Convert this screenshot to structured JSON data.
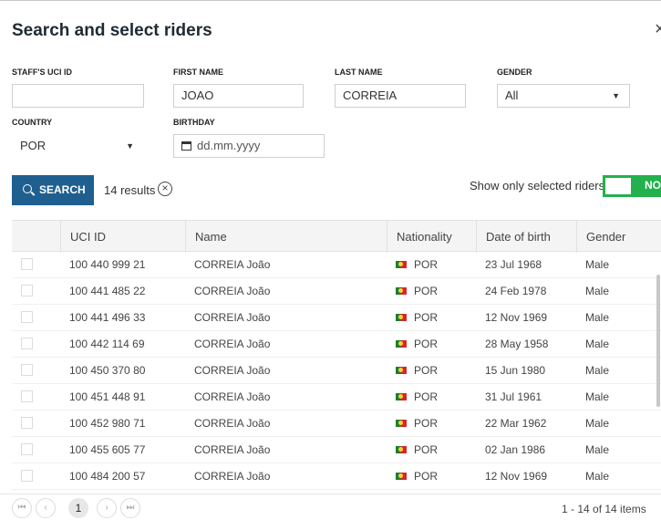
{
  "dialog": {
    "title": "Search and select riders",
    "close_icon": "×"
  },
  "form": {
    "staff_uci_id_label": "STAFF'S UCI ID",
    "staff_uci_id_value": "",
    "first_name_label": "FIRST NAME",
    "first_name_value": "JOAO",
    "last_name_label": "LAST NAME",
    "last_name_value": "CORREIA",
    "gender_label": "GENDER",
    "gender_value": "All",
    "country_label": "COUNTRY",
    "country_value": "POR",
    "birthday_label": "BIRTHDAY",
    "birthday_placeholder": "dd.mm.yyyy"
  },
  "toolbar": {
    "search_label": "SEARCH",
    "results_text": "14 results",
    "clear_icon": "×",
    "show_selected_label": "Show only selected riders",
    "toggle_text": "NO"
  },
  "table": {
    "headers": [
      "UCI ID",
      "Name",
      "Nationality",
      "Date of birth",
      "Gender"
    ],
    "rows": [
      {
        "uci_id": "100 440 999 21",
        "name": "CORREIA João",
        "nationality": "POR",
        "dob": "23 Jul 1968",
        "gender": "Male"
      },
      {
        "uci_id": "100 441 485 22",
        "name": "CORREIA João",
        "nationality": "POR",
        "dob": "24 Feb 1978",
        "gender": "Male"
      },
      {
        "uci_id": "100 441 496 33",
        "name": "CORREIA João",
        "nationality": "POR",
        "dob": "12 Nov 1969",
        "gender": "Male"
      },
      {
        "uci_id": "100 442 114 69",
        "name": "CORREIA João",
        "nationality": "POR",
        "dob": "28 May 1958",
        "gender": "Male"
      },
      {
        "uci_id": "100 450 370 80",
        "name": "CORREIA João",
        "nationality": "POR",
        "dob": "15 Jun 1980",
        "gender": "Male"
      },
      {
        "uci_id": "100 451 448 91",
        "name": "CORREIA João",
        "nationality": "POR",
        "dob": "31 Jul 1961",
        "gender": "Male"
      },
      {
        "uci_id": "100 452 980 71",
        "name": "CORREIA João",
        "nationality": "POR",
        "dob": "22 Mar 1962",
        "gender": "Male"
      },
      {
        "uci_id": "100 455 605 77",
        "name": "CORREIA João",
        "nationality": "POR",
        "dob": "02 Jan 1986",
        "gender": "Male"
      },
      {
        "uci_id": "100 484 200 57",
        "name": "CORREIA João",
        "nationality": "POR",
        "dob": "12 Nov 1969",
        "gender": "Male"
      }
    ]
  },
  "pager": {
    "first_icon": "⏮",
    "prev_icon": "‹",
    "current_page": "1",
    "next_icon": "›",
    "last_icon": "⏭",
    "info": "1 - 14 of 14 items"
  },
  "colors": {
    "accent": "#1f5f8f",
    "toggle": "#22b14c"
  }
}
